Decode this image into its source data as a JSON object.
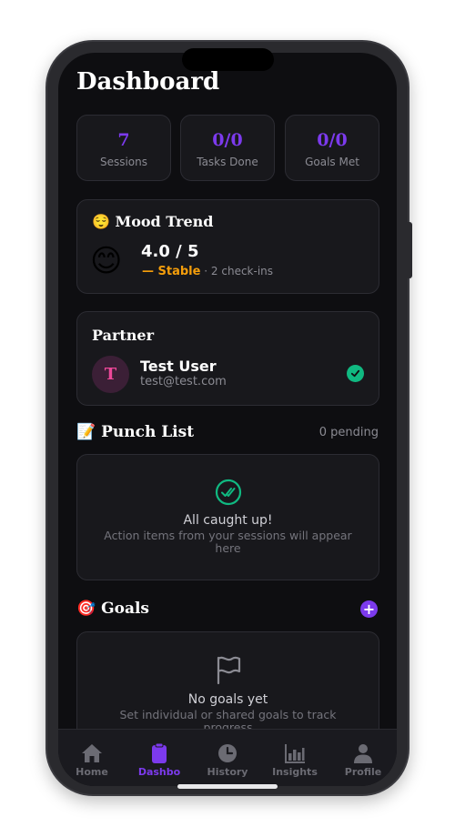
{
  "header": {
    "title": "Dashboard"
  },
  "stats": [
    {
      "value": "7",
      "label": "Sessions"
    },
    {
      "value": "0/0",
      "label": "Tasks Done"
    },
    {
      "value": "0/0",
      "label": "Goals Met"
    }
  ],
  "mood": {
    "title": "😌 Mood Trend",
    "emoji": "😊",
    "score": "4.0 / 5",
    "trend": "— Stable",
    "checkins": "· 2 check-ins",
    "trend_color": "#f59e0b"
  },
  "partner": {
    "title": "Partner",
    "initial": "T",
    "name": "Test User",
    "email": "test@test.com"
  },
  "punch_list": {
    "title": "📝 Punch List",
    "pending": "0 pending",
    "empty_title": "All caught up!",
    "empty_sub": "Action items from your sessions will appear here",
    "icon": "double-check-circle-icon"
  },
  "goals": {
    "title": "🎯 Goals",
    "add_label": "+",
    "empty_title": "No goals yet",
    "empty_sub": "Set individual or shared goals to track progress",
    "icon": "flag-icon"
  },
  "tabs": [
    {
      "label": "Home",
      "icon": "home-icon",
      "active": false
    },
    {
      "label": "Dashbo",
      "icon": "clipboard-icon",
      "active": true
    },
    {
      "label": "History",
      "icon": "clock-icon",
      "active": false
    },
    {
      "label": "Insights",
      "icon": "bar-chart-icon",
      "active": false
    },
    {
      "label": "Profile",
      "icon": "person-icon",
      "active": false
    }
  ],
  "colors": {
    "accent": "#7c3aed",
    "success": "#10b981",
    "background": "#0e0e11",
    "card": "#18181c"
  }
}
